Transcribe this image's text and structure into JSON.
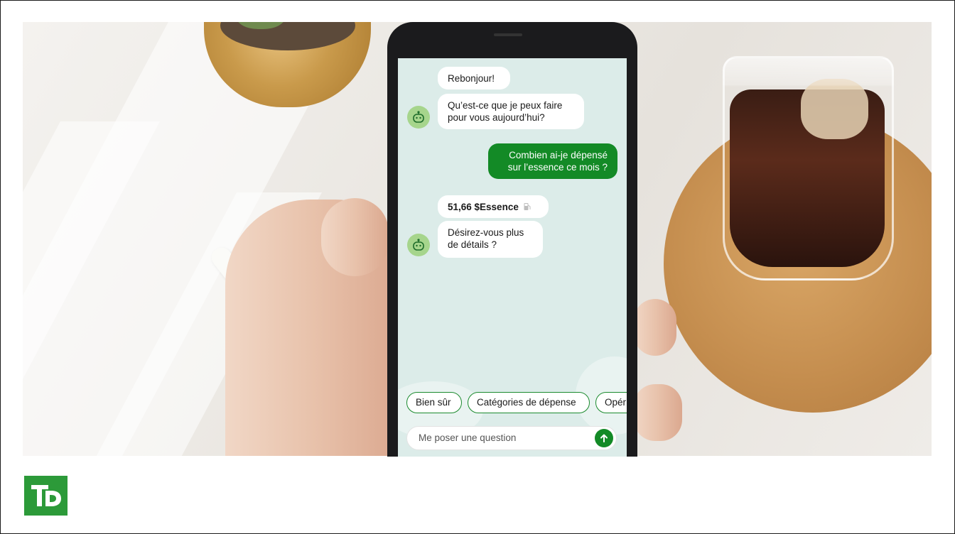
{
  "chat": {
    "messages": {
      "greeting": "Rebonjour!",
      "prompt": "Qu’est-ce que je peux faire pour vous aujourd’hui?",
      "user_question": "Combien ai-je dépensé sur l’essence ce mois ?",
      "amount": "51,66 $Essence",
      "followup": "Désirez-vous plus de détails ?"
    },
    "quick_replies": [
      "Bien sûr",
      "Catégories de dépense",
      "Opér"
    ],
    "input": {
      "placeholder": "Me poser une question"
    }
  },
  "brand": {
    "logo_text": "TD",
    "color": "#2c9a39",
    "accent": "#138a26"
  },
  "icons": {
    "bot": "robot-icon",
    "fuel": "fuel-pump-icon",
    "send": "arrow-up-icon"
  }
}
